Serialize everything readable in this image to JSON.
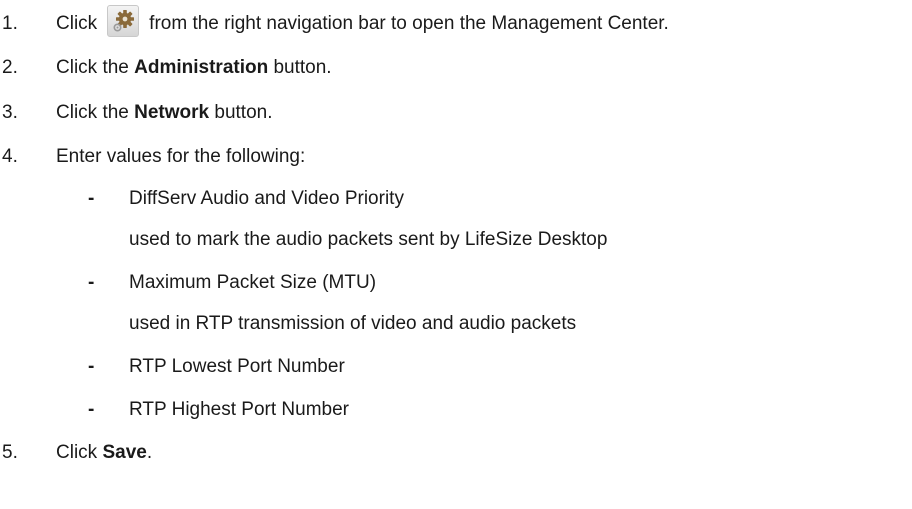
{
  "steps": [
    {
      "number": "1.",
      "before": "Click",
      "icon": "gear-icon",
      "after": "from the right navigation bar to open the Management Center."
    },
    {
      "number": "2.",
      "before": "Click the ",
      "bold": "Administration",
      "after": " button."
    },
    {
      "number": "3.",
      "before": "Click the ",
      "bold": "Network",
      "after": " button."
    },
    {
      "number": "4.",
      "text": "Enter values for the following:",
      "items": [
        {
          "bullet": "-",
          "title": "DiffServ Audio and Video Priority",
          "description": "used to mark the audio packets sent by LifeSize Desktop"
        },
        {
          "bullet": "-",
          "title": "Maximum Packet Size (MTU)",
          "description": "used in RTP transmission of video and audio packets"
        },
        {
          "bullet": "-",
          "title": "RTP Lowest Port Number"
        },
        {
          "bullet": "-",
          "title": "RTP Highest Port Number"
        }
      ]
    },
    {
      "number": "5.",
      "before": "Click ",
      "bold": "Save",
      "after": "."
    }
  ]
}
